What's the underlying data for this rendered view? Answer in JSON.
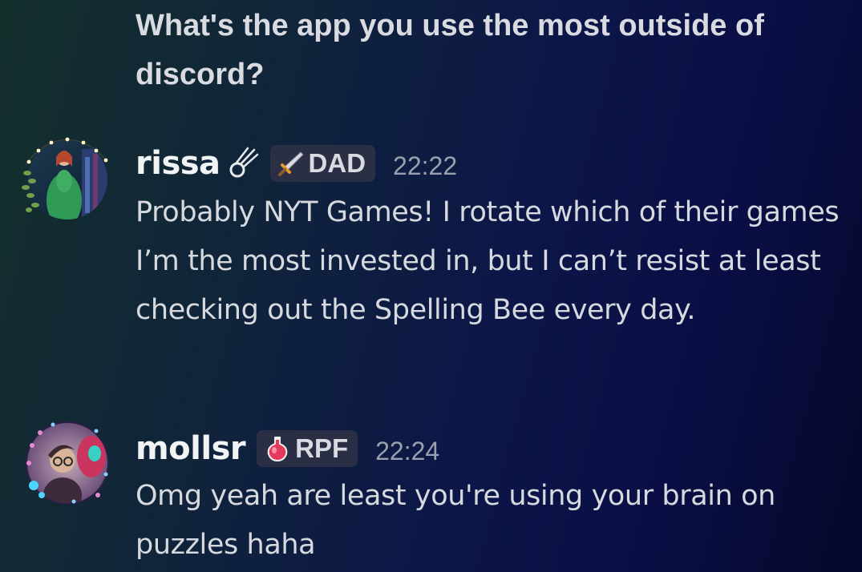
{
  "prompt": {
    "text": "What's the app you use the most outside of discord?"
  },
  "messages": [
    {
      "username": "rissa",
      "user_glyph": "comet-icon",
      "tag": {
        "icon": "sword-icon",
        "label": "DAD"
      },
      "time": "22:22",
      "text": "Probably NYT Games! I rotate which of their games I’m the most invested in, but I can’t resist at least checking out the Spelling Bee every day."
    },
    {
      "username": "mollsr",
      "tag": {
        "icon": "potion-icon",
        "label": "RPF"
      },
      "time": "22:24",
      "text": "Omg yeah are least you're using your brain on puzzles haha"
    }
  ]
}
